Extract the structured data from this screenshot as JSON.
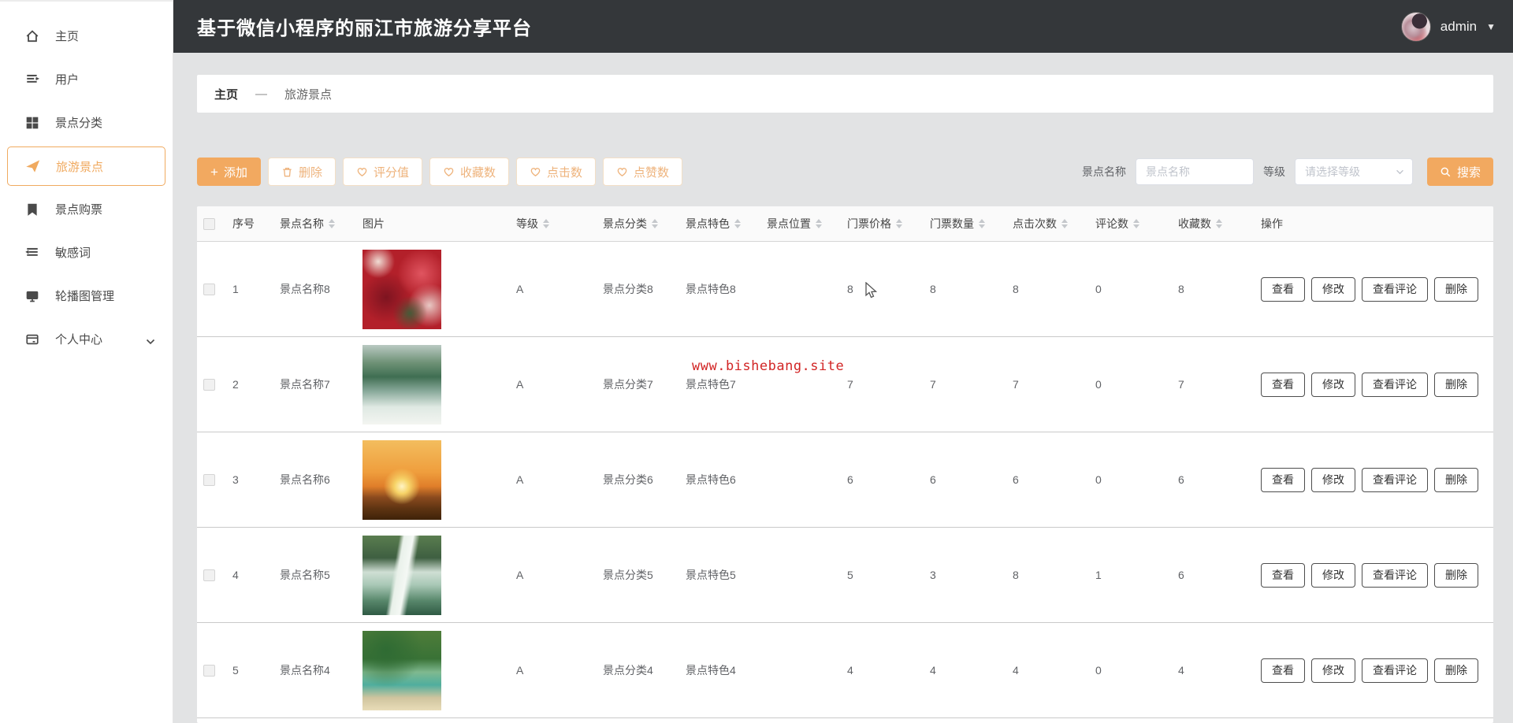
{
  "app": {
    "title": "基于微信小程序的丽江市旅游分享平台",
    "accent_color": "#f2a960",
    "topbar_color": "#34373a",
    "user": {
      "name": "admin",
      "caret": "▼"
    }
  },
  "sidebar": {
    "items": [
      {
        "label": "主页",
        "icon": "home-icon",
        "active": false
      },
      {
        "label": "用户",
        "icon": "users-list-icon",
        "active": false
      },
      {
        "label": "景点分类",
        "icon": "grid-icon",
        "active": false
      },
      {
        "label": "旅游景点",
        "icon": "paper-plane-icon",
        "active": true
      },
      {
        "label": "景点购票",
        "icon": "ticket-book-icon",
        "active": false
      },
      {
        "label": "敏感词",
        "icon": "list-lines-icon",
        "active": false
      },
      {
        "label": "轮播图管理",
        "icon": "monitor-icon",
        "active": false
      },
      {
        "label": "个人中心",
        "icon": "card-icon",
        "active": false,
        "expandable": true
      }
    ]
  },
  "breadcrumb": {
    "home": "主页",
    "separator": "—",
    "current": "旅游景点"
  },
  "toolbar": {
    "add": "添加",
    "delete": "删除",
    "score": "评分值",
    "favorites": "收藏数",
    "clicks": "点击数",
    "likes": "点赞数",
    "search": {
      "name_label": "景点名称",
      "name_placeholder": "景点名称",
      "level_label": "等级",
      "level_placeholder": "请选择等级",
      "button": "搜索"
    }
  },
  "table": {
    "columns": [
      {
        "label": "序号",
        "sortable": false
      },
      {
        "label": "景点名称",
        "sortable": true
      },
      {
        "label": "图片",
        "sortable": false
      },
      {
        "label": "等级",
        "sortable": true
      },
      {
        "label": "景点分类",
        "sortable": true
      },
      {
        "label": "景点特色",
        "sortable": true
      },
      {
        "label": "景点位置",
        "sortable": true
      },
      {
        "label": "门票价格",
        "sortable": true
      },
      {
        "label": "门票数量",
        "sortable": true
      },
      {
        "label": "点击次数",
        "sortable": true
      },
      {
        "label": "评论数",
        "sortable": true
      },
      {
        "label": "收藏数",
        "sortable": true
      },
      {
        "label": "操作",
        "sortable": false
      }
    ],
    "actions": {
      "view": "查看",
      "edit": "修改",
      "view_comments": "查看评论",
      "delete": "删除"
    },
    "rows": [
      {
        "index": "1",
        "name": "景点名称8",
        "image": "red-autumn-foliage",
        "level": "A",
        "category": "景点分类8",
        "feature": "景点特色8",
        "location": "",
        "price": "8",
        "quantity": "8",
        "clicks": "8",
        "comments": "0",
        "favorites": "8"
      },
      {
        "index": "2",
        "name": "景点名称7",
        "image": "misty-mountain-river",
        "level": "A",
        "category": "景点分类7",
        "feature": "景点特色7",
        "location": "",
        "price": "7",
        "quantity": "7",
        "clicks": "7",
        "comments": "0",
        "favorites": "7"
      },
      {
        "index": "3",
        "name": "景点名称6",
        "image": "sunset-over-dunes",
        "level": "A",
        "category": "景点分类6",
        "feature": "景点特色6",
        "location": "",
        "price": "6",
        "quantity": "6",
        "clicks": "6",
        "comments": "0",
        "favorites": "6"
      },
      {
        "index": "4",
        "name": "景点名称5",
        "image": "waterfall",
        "level": "A",
        "category": "景点分类5",
        "feature": "景点特色5",
        "location": "",
        "price": "5",
        "quantity": "3",
        "clicks": "8",
        "comments": "1",
        "favorites": "6"
      },
      {
        "index": "5",
        "name": "景点名称4",
        "image": "palm-beach",
        "level": "A",
        "category": "景点分类4",
        "feature": "景点特色4",
        "location": "",
        "price": "4",
        "quantity": "4",
        "clicks": "4",
        "comments": "0",
        "favorites": "4"
      }
    ]
  },
  "watermark": "www.bishebang.site"
}
